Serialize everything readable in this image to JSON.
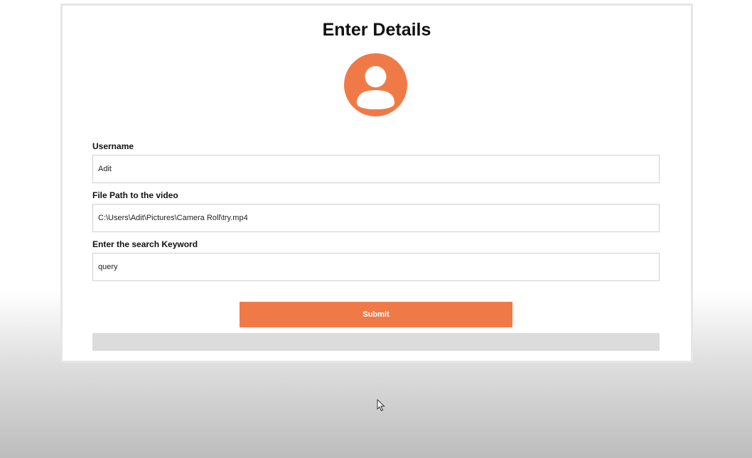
{
  "form": {
    "title": "Enter Details",
    "avatar_icon": "user-avatar-icon",
    "accent_color": "#f07a47",
    "fields": [
      {
        "label": "Username",
        "value": "Adit",
        "placeholder": ""
      },
      {
        "label": "File Path to the video",
        "value": "C:\\Users\\Adit\\Pictures\\Camera Roll\\try.mp4",
        "placeholder": ""
      },
      {
        "label": "Enter the search Keyword",
        "value": "query",
        "placeholder": ""
      }
    ],
    "submit_label": "Submit",
    "cursor_icon": "mouse-pointer-icon"
  }
}
